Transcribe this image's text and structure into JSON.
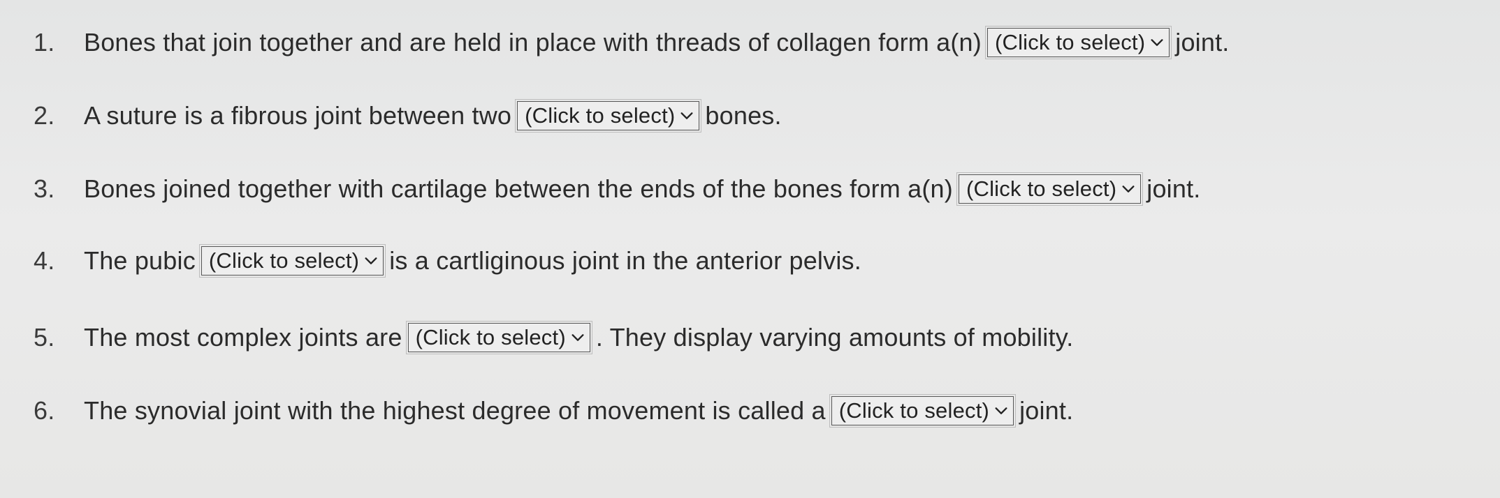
{
  "questions": [
    {
      "number": "1.",
      "before": "Bones that join together and are held in place with threads of collagen form a(n)",
      "select": "(Click to select)",
      "after": "joint."
    },
    {
      "number": "2.",
      "before": "A suture is a fibrous joint between two",
      "select": "(Click to select)",
      "after": "bones."
    },
    {
      "number": "3.",
      "before": "Bones joined together with cartilage between the ends of the bones form a(n)",
      "select": "(Click to select)",
      "after": "joint."
    },
    {
      "number": "4.",
      "before": "The pubic",
      "select": "(Click to select)",
      "after": "is a cartliginous joint in the anterior pelvis."
    },
    {
      "number": "5.",
      "before": "The most complex joints are",
      "select": "(Click to select)",
      "after": ". They display varying amounts of mobility."
    },
    {
      "number": "6.",
      "before": "The synovial joint with the highest degree of movement is called a",
      "select": "(Click to select)",
      "after": "joint."
    }
  ],
  "icons": {
    "dropdown": "chevron-down-icon"
  },
  "colors": {
    "background": "#e8e8e8",
    "text": "#2b2b2b",
    "border": "#555555"
  }
}
